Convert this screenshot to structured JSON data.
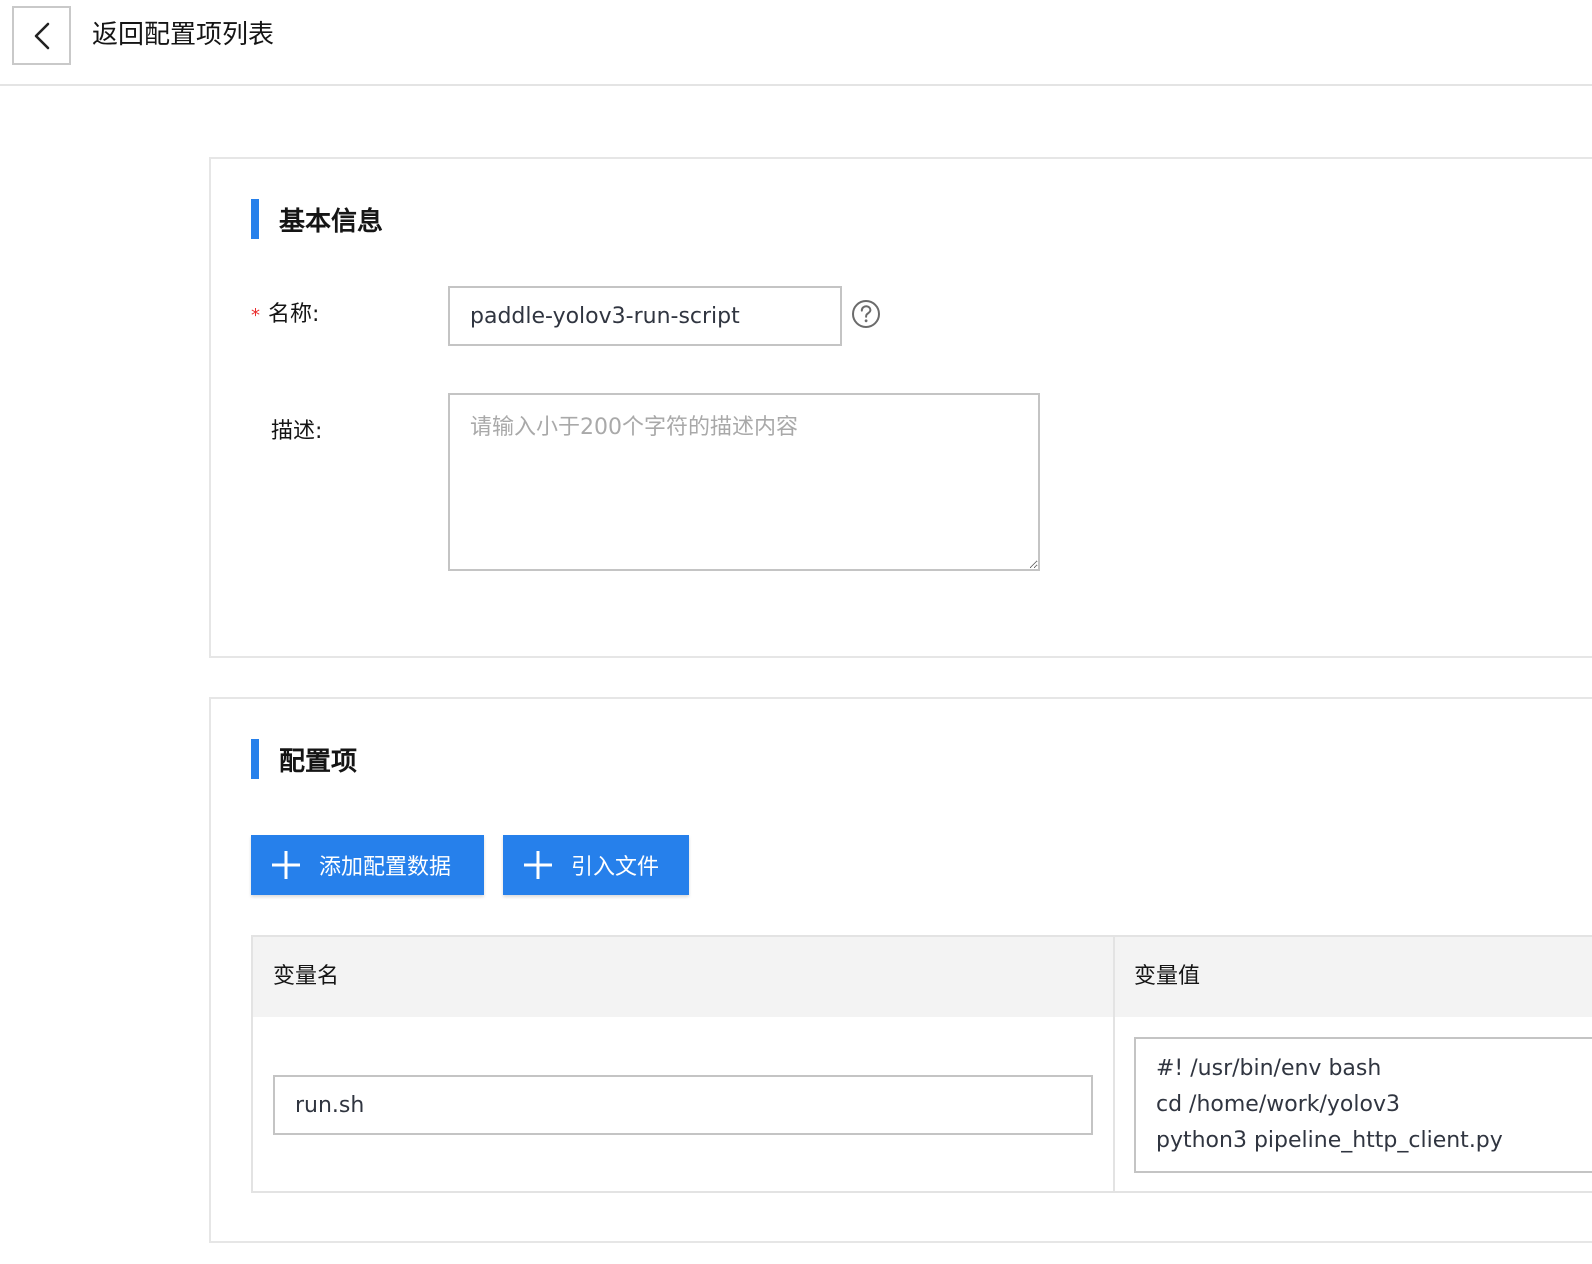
{
  "header": {
    "back_label": "返回配置项列表"
  },
  "basic_info": {
    "section_title": "基本信息",
    "name_label": "名称:",
    "name_value": "paddle-yolov3-run-script",
    "desc_label": "描述:",
    "desc_placeholder": "请输入小于200个字符的描述内容",
    "desc_value": ""
  },
  "config": {
    "section_title": "配置项",
    "add_data_button": "添加配置数据",
    "import_file_button": "引入文件",
    "table": {
      "columns": [
        "变量名",
        "变量值"
      ],
      "rows": [
        {
          "name": "run.sh",
          "value_lines": [
            "#! /usr/bin/env bash",
            "cd /home/work/yolov3",
            "python3 pipeline_http_client.py"
          ]
        }
      ]
    }
  },
  "colors": {
    "accent": "#2680eb",
    "required": "#ea2e2e",
    "border": "#c4c4c4",
    "table_header_bg": "#f3f3f3"
  },
  "icons": [
    "chevron-left-icon",
    "help-circle-icon",
    "plus-icon"
  ]
}
